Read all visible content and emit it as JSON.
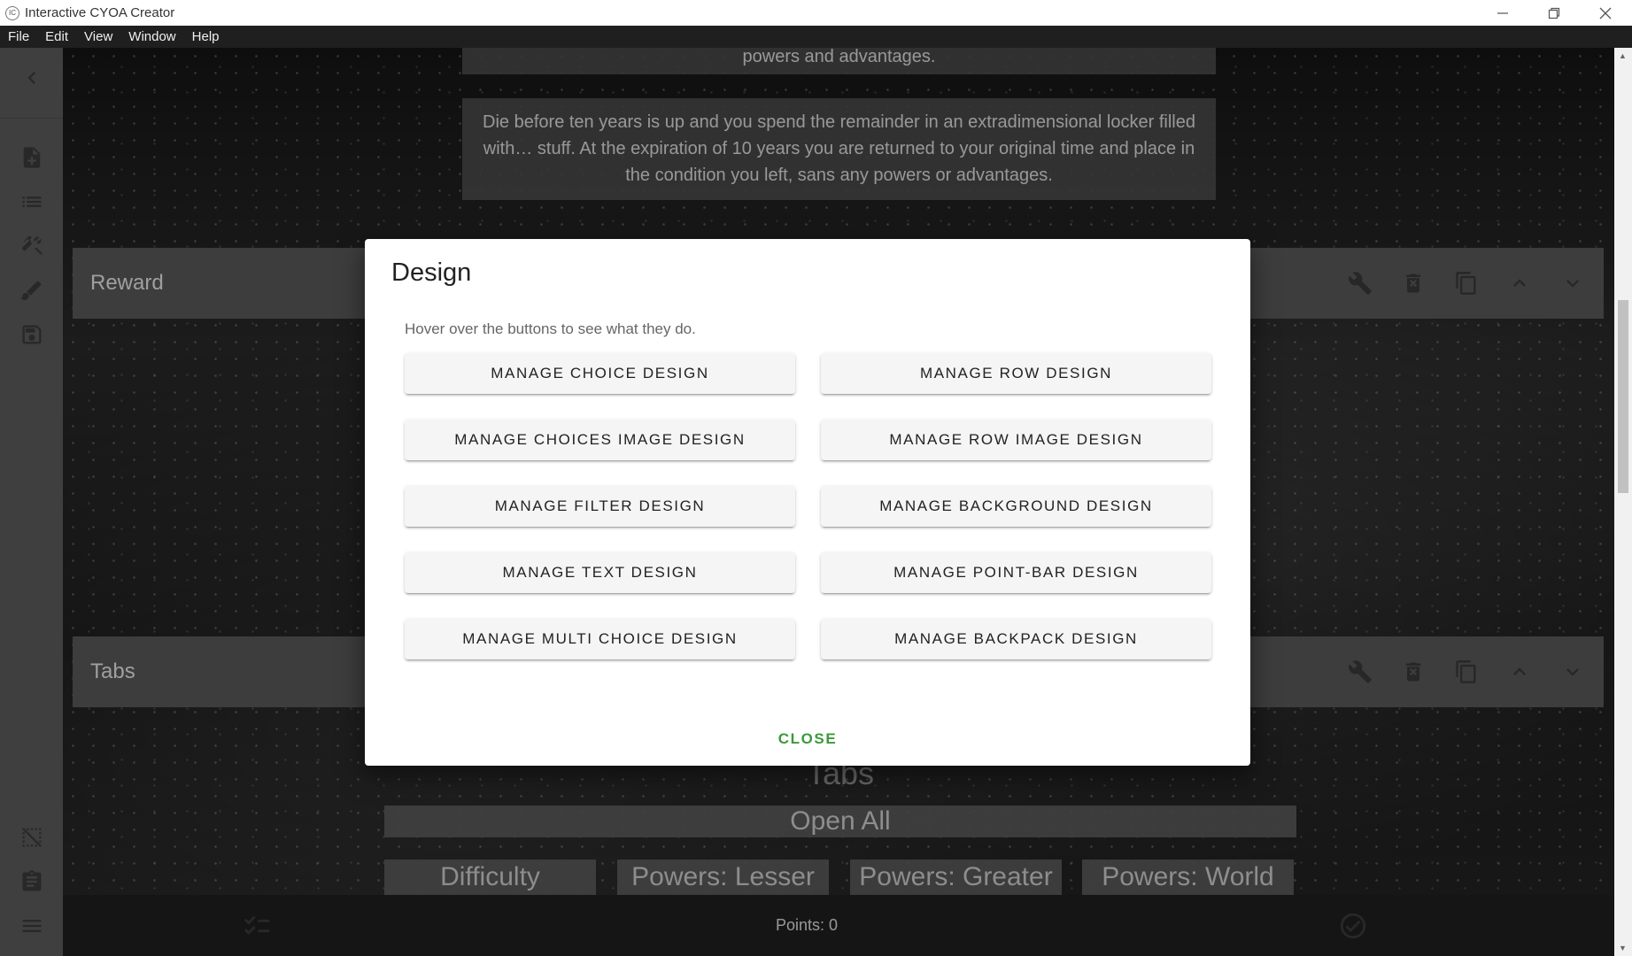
{
  "window": {
    "title": "Interactive CYOA Creator",
    "app_icon_text": "IC"
  },
  "menu": [
    "File",
    "Edit",
    "View",
    "Window",
    "Help"
  ],
  "sidebar": {
    "icons": [
      "chevron-left-icon",
      "new-file-icon",
      "list-icon",
      "tools-icon",
      "brush-icon",
      "save-icon",
      "filter-off-icon",
      "clipboard-icon",
      "menu-icon"
    ]
  },
  "background_content": {
    "text_top_fragment": "powers and advantages.",
    "text_paragraph": "Die before ten years is up and you spend the remainder in an extradimensional locker filled with… stuff. At the expiration of 10 years you are returned to your original time and place in the condition you left, sans any powers or advantages.",
    "rows": [
      {
        "title": "Reward"
      },
      {
        "title": "Tabs"
      }
    ],
    "tabs_heading": "Tabs",
    "open_all": "Open All",
    "tab_buttons": [
      "Difficulty",
      "Powers: Lesser",
      "Powers: Greater",
      "Powers: World"
    ]
  },
  "bottom_bar": {
    "points_label": "Points: 0"
  },
  "dialog": {
    "title": "Design",
    "hint": "Hover over the buttons to see what they do.",
    "buttons_left": [
      "MANAGE CHOICE DESIGN",
      "MANAGE CHOICES IMAGE DESIGN",
      "MANAGE FILTER DESIGN",
      "MANAGE TEXT DESIGN",
      "MANAGE MULTI CHOICE DESIGN"
    ],
    "buttons_right": [
      "MANAGE ROW DESIGN",
      "MANAGE ROW IMAGE DESIGN",
      "MANAGE BACKGROUND DESIGN",
      "MANAGE POINT-BAR DESIGN",
      "MANAGE BACKPACK DESIGN"
    ],
    "close_label": "CLOSE",
    "accent_color": "#3a9a3a"
  }
}
